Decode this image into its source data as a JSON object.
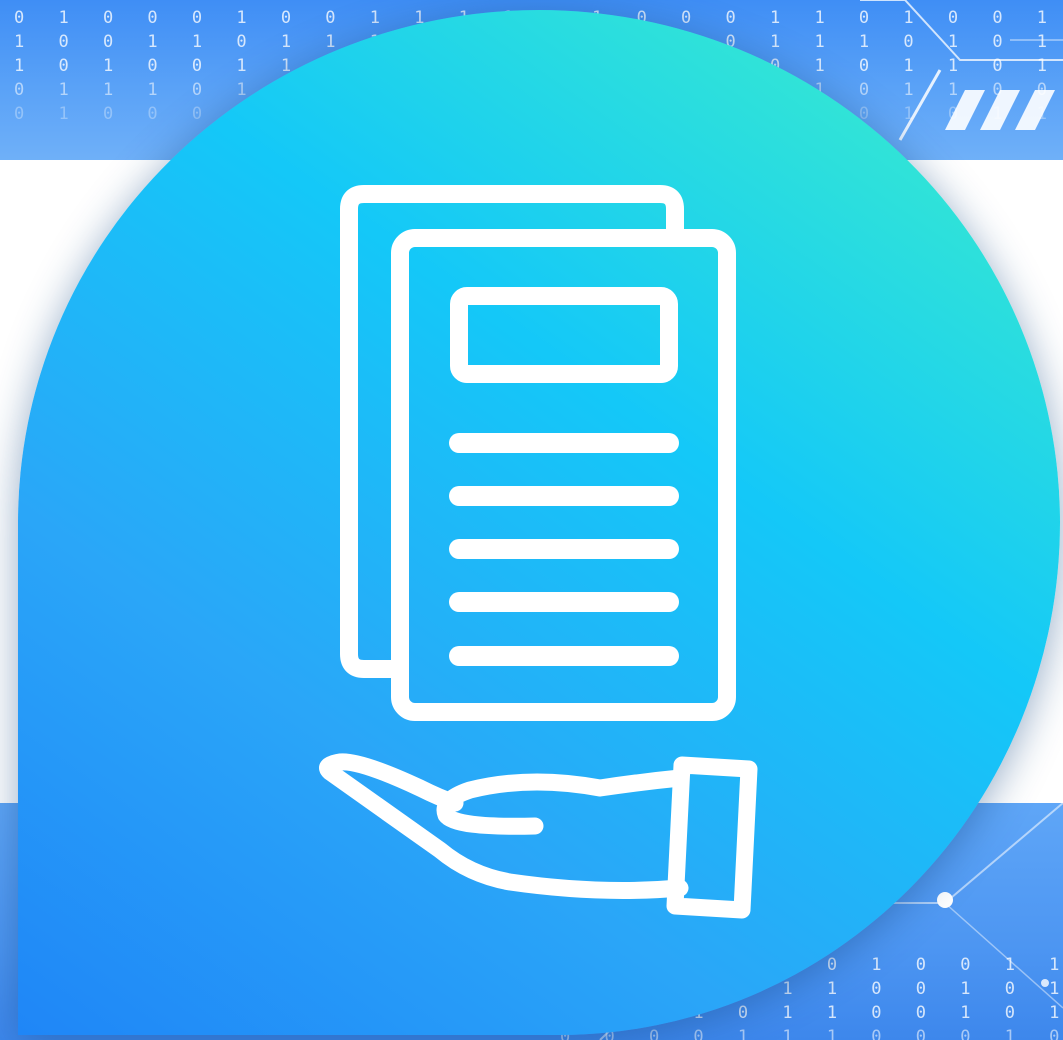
{
  "binary": {
    "top_rows": [
      "0 1 0 0 0 1 0 0 1 1 1 1 1 1 0 0 0 1 1 0 1 0 0 1 1 0 1 1 0 1 1 1 0 1 0 1 0 1",
      "1 0 0 1 1 0 1 1 1 1 0 0 0 0 1 0 0 1 1 1 0 1 0 1 0 1 0 1 0 1 0 1 0 0 0 1 1 1",
      "1 0 1 0 0 1 1 1 1 1 1 0 1 0 0 0 1 0 1 0 1 1 0 1 1 0 1 0 1 0 1 0 0 1 0 1 0 1",
      "0 1 1 1 0 1 1 0 1 0 1 0 0 1 1 1 0 0 1 0 1 1 0 0 0 1 1 0 1 0 0 1 0 1 1 0 1 0",
      "0 1 0 0 0 1 1 0 1 1 0 0 1 0 1 1 0 1 0 0 1 0 1 1 0 0 1 0 1 1 0 1 0 0 1 0 1 1"
    ],
    "bottom_rows": [
      "0 0 1 0 0 1 0 1 0 0 1 1 0",
      "1 1 0 1 0 1 1 0 0 1 0 1 1",
      "1 1 0 1 0 1 1 0 0 1 0 1 0",
      "0 0 0 0 1 1 1 0 0 0 1 0 1"
    ]
  },
  "icon": {
    "name": "document-in-hand-icon",
    "stroke_color": "#ffffff"
  },
  "colors": {
    "band_blue": "#4d96f2",
    "gradient_start": "#1f86f7",
    "gradient_mid": "#14c8f8",
    "gradient_end": "#40f2c6"
  }
}
